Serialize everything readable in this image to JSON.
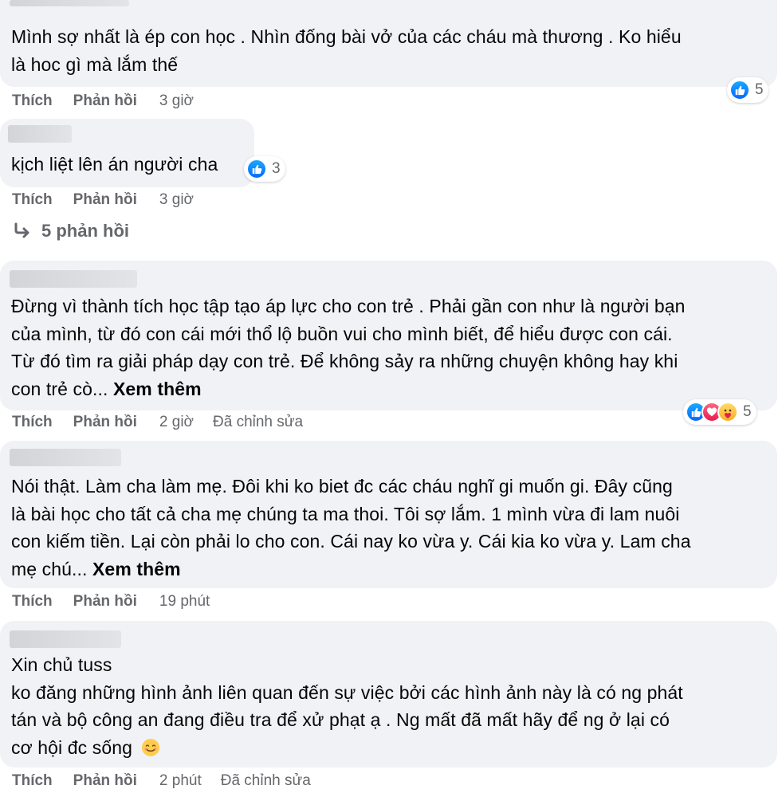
{
  "comments": [
    {
      "text": "Mình sợ nhất là ép con học . Nhìn đống bài vở của các cháu mà thương . Ko hiểu\nlà hoc gì mà lắm thế",
      "see_more": "",
      "actions": {
        "like": "Thích",
        "reply": "Phản hồi",
        "time": "3 giờ",
        "edited": ""
      },
      "reaction_count": "5"
    },
    {
      "text": "kịch liệt lên án người cha",
      "see_more": "",
      "actions": {
        "like": "Thích",
        "reply": "Phản hồi",
        "time": "3 giờ",
        "edited": ""
      },
      "reaction_count": "3",
      "replies_link": "5 phản hồi"
    },
    {
      "text": "Đừng vì thành tích học tập tạo áp lực cho con trẻ . Phải gần con như là người bạn\ncủa mình, từ đó con cái mới thổ lộ buồn vui cho mình biết, để hiểu được con cái.\nTừ đó tìm ra giải pháp dạy con trẻ. Để không sảy ra những chuyện không hay khi\ncon trẻ cò... ",
      "see_more": "Xem thêm",
      "actions": {
        "like": "Thích",
        "reply": "Phản hồi",
        "time": "2 giờ",
        "edited": "Đã chỉnh sửa"
      },
      "reaction_count": "5"
    },
    {
      "text": "Nói thật. Làm cha làm mẹ. Đôi khi ko biet đc các cháu nghĩ gi muốn gi. Đây cũng\nlà bài học cho tất cả cha mẹ chúng ta ma thoi. Tôi sợ lắm. 1 mình vừa đi lam nuôi\ncon kiếm tiền. Lại còn phải lo cho con. Cái nay ko vừa y. Cái kia ko vừa y. Lam cha\nmẹ chú... ",
      "see_more": "Xem thêm",
      "actions": {
        "like": "Thích",
        "reply": "Phản hồi",
        "time": "19 phút",
        "edited": ""
      },
      "reaction_count": ""
    },
    {
      "text": "Xin chủ tuss\nko đăng những hình ảnh liên quan đến sự việc bởi các hình ảnh này là có ng phát\ntán và bộ công an đang điều tra để xử phạt ạ . Ng mất đã mất hãy để ng ở lại có\ncơ hội đc sống ",
      "see_more": "",
      "actions": {
        "like": "Thích",
        "reply": "Phản hồi",
        "time": "2 phút",
        "edited": "Đã chỉnh sửa"
      },
      "reaction_count": ""
    }
  ],
  "colors": {
    "bubble": "#f0f2f5",
    "meta": "#65676b",
    "like_blue": "#0866ff",
    "love_red": "#e61e4d",
    "care_yellow": "#f7b125"
  },
  "icons": [
    "like-reaction-icon",
    "love-reaction-icon",
    "care-reaction-icon",
    "reply-arrow-icon",
    "smiling-emoji-icon"
  ]
}
